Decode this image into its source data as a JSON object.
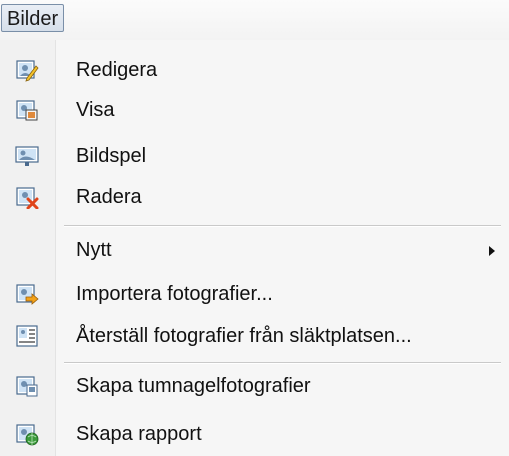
{
  "menubar": {
    "title": "Bilder"
  },
  "menu": {
    "items": [
      {
        "label": "Redigera",
        "icon": "edit-picture-icon"
      },
      {
        "label": "Visa",
        "icon": "view-picture-icon"
      },
      {
        "label": "Bildspel",
        "icon": "slideshow-icon"
      },
      {
        "label": "Radera",
        "icon": "delete-picture-icon"
      },
      {
        "label": "Nytt",
        "icon": "",
        "submenu": true
      },
      {
        "label": "Importera fotografier...",
        "icon": "import-photos-icon"
      },
      {
        "label": "Återställ fotografier från släktplatsen...",
        "icon": "restore-photos-icon"
      },
      {
        "label": "Skapa tumnagelfotografier",
        "icon": "create-thumbnails-icon"
      },
      {
        "label": "Skapa rapport",
        "icon": "create-report-icon"
      }
    ]
  },
  "colors": {
    "accent": "#2f6db5",
    "delete": "#e0451b",
    "arrow": "#f2a21a",
    "globe": "#3b9a3b"
  }
}
